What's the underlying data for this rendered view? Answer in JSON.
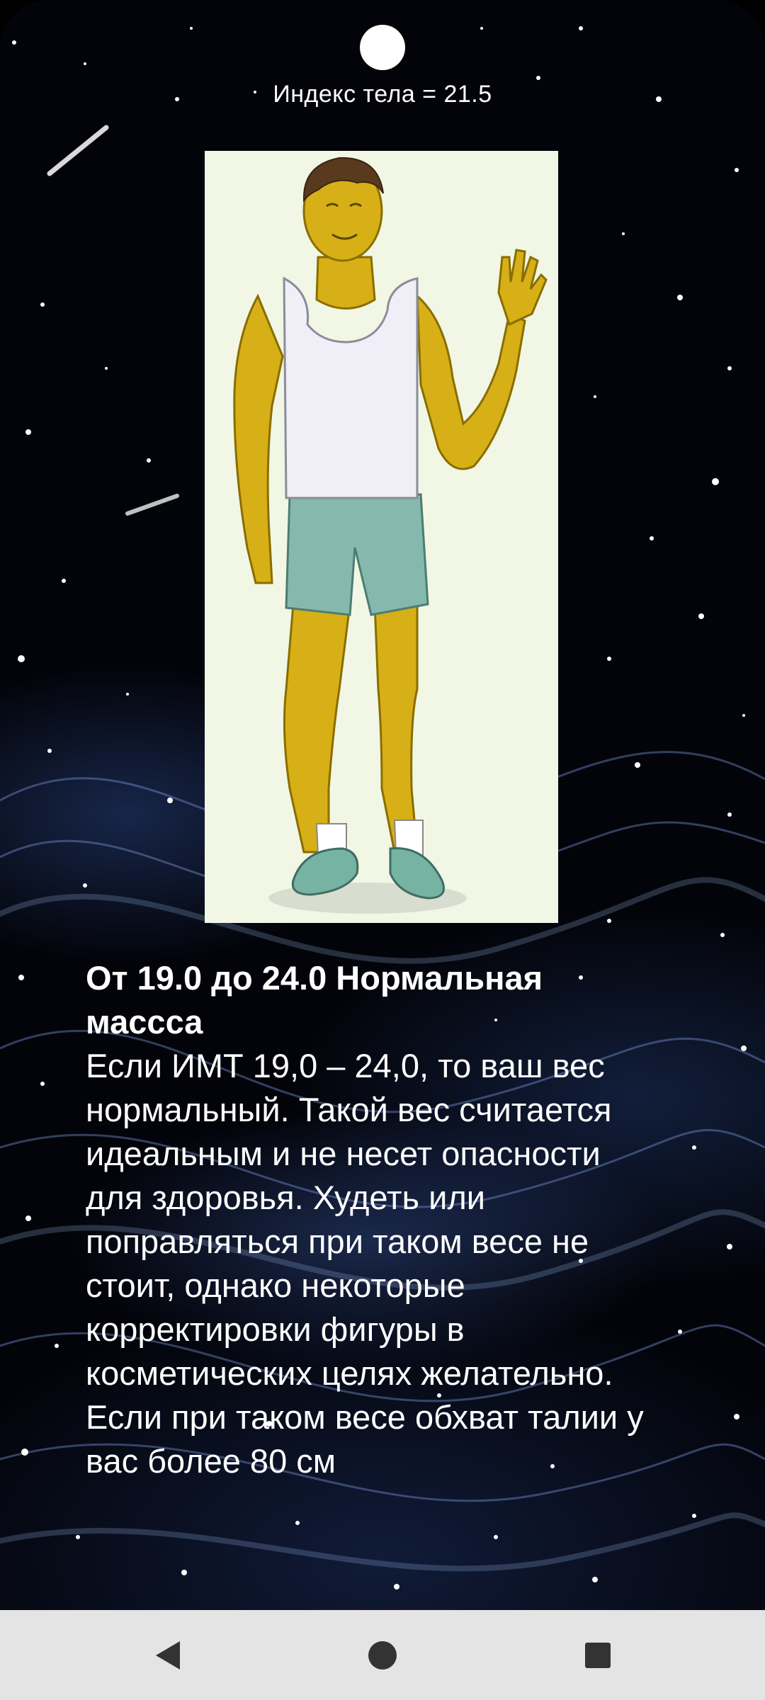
{
  "header": {
    "index_label": "Индекс тела = 21.5"
  },
  "figure": {
    "icon": "waving-man-illustration",
    "background_color": "#f1f7e4"
  },
  "description": {
    "title": " От 19.0 до 24.0 Нормальная массса",
    "body": " Если ИМТ 19,0 – 24,0, то ваш вес нормальный. Такой вес считается идеальным и не несет опасности для здоровья. Худеть или поправляться при таком весе не стоит, однако некоторые корректировки фигуры в косметических целях желательно. Если при таком весе обхват талии у вас более 80 см"
  },
  "navigation": {
    "back_icon": "triangle-back-icon",
    "home_icon": "circle-home-icon",
    "recents_icon": "square-recents-icon"
  },
  "colors": {
    "background": "#000000",
    "text": "#ffffff",
    "nav_bar": "#e4e4e4",
    "nav_icons": "#333333"
  }
}
